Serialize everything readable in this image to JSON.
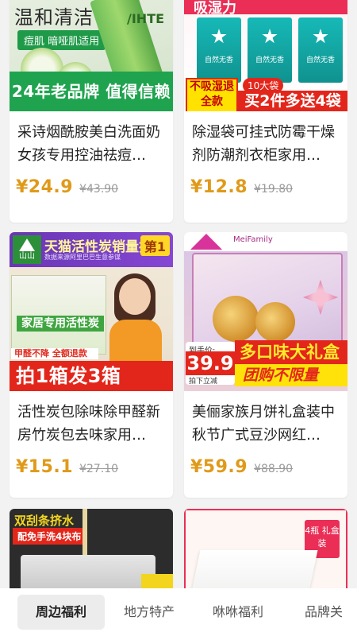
{
  "products": [
    {
      "title": "采诗烟酰胺美白洗面奶女孩专用控油祛痘…",
      "price": "¥24.9",
      "old_price": "¥43.90",
      "image": {
        "headline": "温和清洁",
        "pill": "痘肌 暗哑肌适用",
        "tube_text": "/IHTE",
        "band": "24年老品牌 值得信赖"
      }
    },
    {
      "title": "除湿袋可挂式防霉干燥剂防潮剂衣柜家用…",
      "price": "¥12.8",
      "old_price": "¥19.80",
      "image": {
        "top": "吸湿力",
        "pack_text": "自然无香",
        "badge": "不吸湿退全款",
        "pill": "10大袋",
        "promo": "买2件多送4袋"
      }
    },
    {
      "title": "活性炭包除味除甲醛新房竹炭包去味家用…",
      "price": "¥15.1",
      "old_price": "¥27.10",
      "image": {
        "logo": "山山",
        "title": "天猫活性炭销量排行",
        "first": "第1",
        "subtitle": "数据来源阿里巴巴生意参谋",
        "box_label": "家居专用活性炭",
        "strip1": "甲醛不降 全额退款",
        "strip2": "拍1箱发3箱"
      }
    },
    {
      "title": "美俪家族月饼礼盒装中秋节广式豆沙网红…",
      "price": "¥59.9",
      "old_price": "¥88.90",
      "image": {
        "brand": "MeiFamily",
        "pre": "到手价:",
        "big": "39.9",
        "post": "拍下立减",
        "b1": "多口味大礼盒",
        "b2": "团购不限量"
      }
    },
    {
      "title": "",
      "price": "",
      "old_price": "",
      "image": {
        "t1": "双刮条挤水",
        "t2": "配免手洗4块布"
      }
    },
    {
      "title": "",
      "price": "",
      "old_price": "",
      "image": {
        "tag": "4瓶 礼盒装"
      }
    }
  ],
  "tabs": [
    {
      "label": "周边福利",
      "active": true
    },
    {
      "label": "地方特产",
      "active": false
    },
    {
      "label": "咻咻福利",
      "active": false
    },
    {
      "label": "品牌关",
      "active": false
    }
  ],
  "colors": {
    "price": "#e09a1a",
    "accent_red": "#e3261b",
    "page_bg": "#f2f2f2"
  }
}
